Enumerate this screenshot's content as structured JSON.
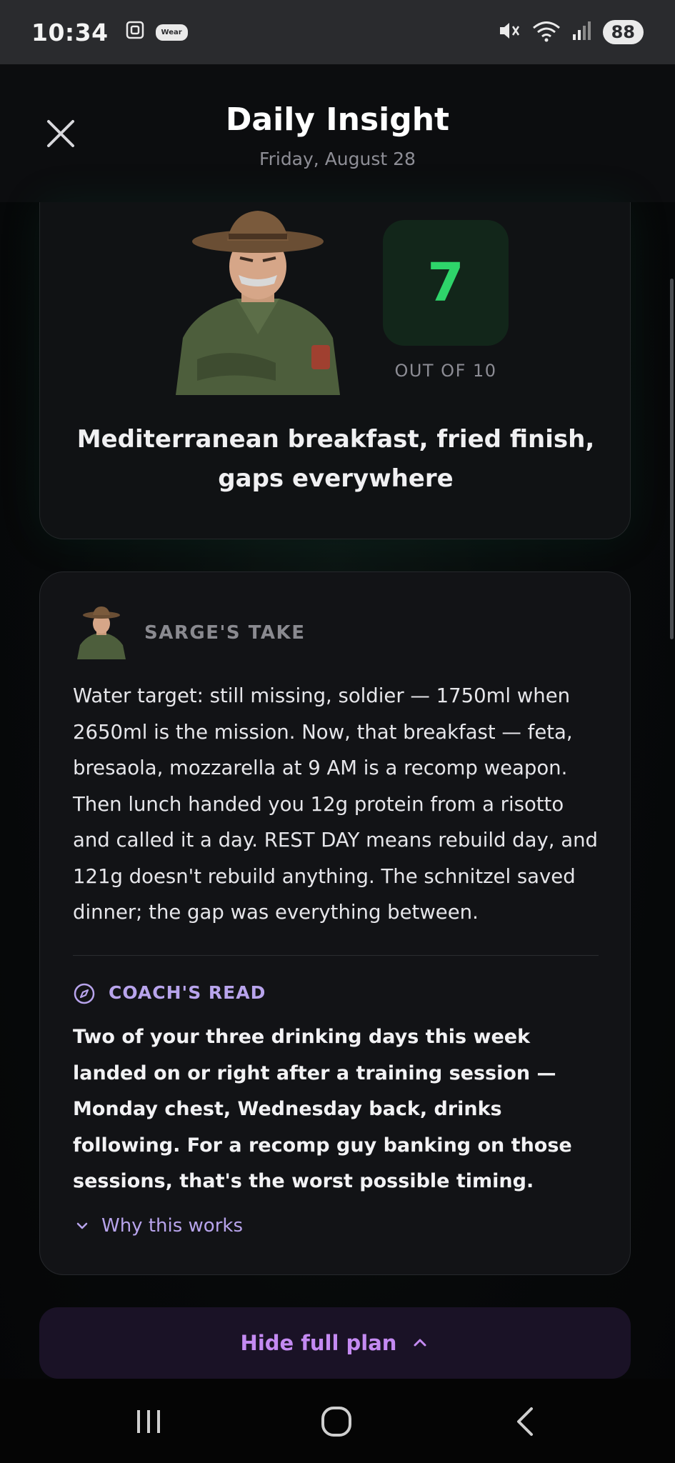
{
  "status_bar": {
    "time": "10:34",
    "wear_badge": "Wear",
    "battery": "88",
    "icons": [
      "screenshot-icon",
      "wear-badge-icon",
      "mute-icon",
      "wifi-icon",
      "signal-icon",
      "battery-icon"
    ]
  },
  "header": {
    "title": "Daily Insight",
    "date": "Friday, August 28",
    "close_icon": "close-icon"
  },
  "score": {
    "value": "7",
    "scale": "OUT OF 10",
    "headline": "Mediterranean breakfast, fried finish, gaps everywhere",
    "color": "#2ed46a"
  },
  "sarge": {
    "label": "SARGE'S TAKE",
    "body": "Water target: still missing, soldier — 1750ml when 2650ml is the mission. Now, that breakfast — feta, bresaola, mozzarella at 9 AM is a recomp weapon. Then lunch handed you 12g protein from a risotto and called it a day. REST DAY means rebuild day, and 121g doesn't rebuild anything. The schnitzel saved dinner; the gap was everything between."
  },
  "coach": {
    "label": "COACH'S READ",
    "icon": "compass-icon",
    "body": "Two of your three drinking days this week landed on or right after a training session — Monday chest, Wednesday back, drinks following. For a recomp guy banking on those sessions, that's the worst possible timing.",
    "why_label": "Why this works",
    "accent": "#b8a4ec"
  },
  "plan_toggle": {
    "label": "Hide full plan",
    "icon": "chevron-up-icon",
    "accent": "#c48af2"
  },
  "nav": {
    "items": [
      "recent-apps-icon",
      "home-icon",
      "back-icon"
    ]
  }
}
